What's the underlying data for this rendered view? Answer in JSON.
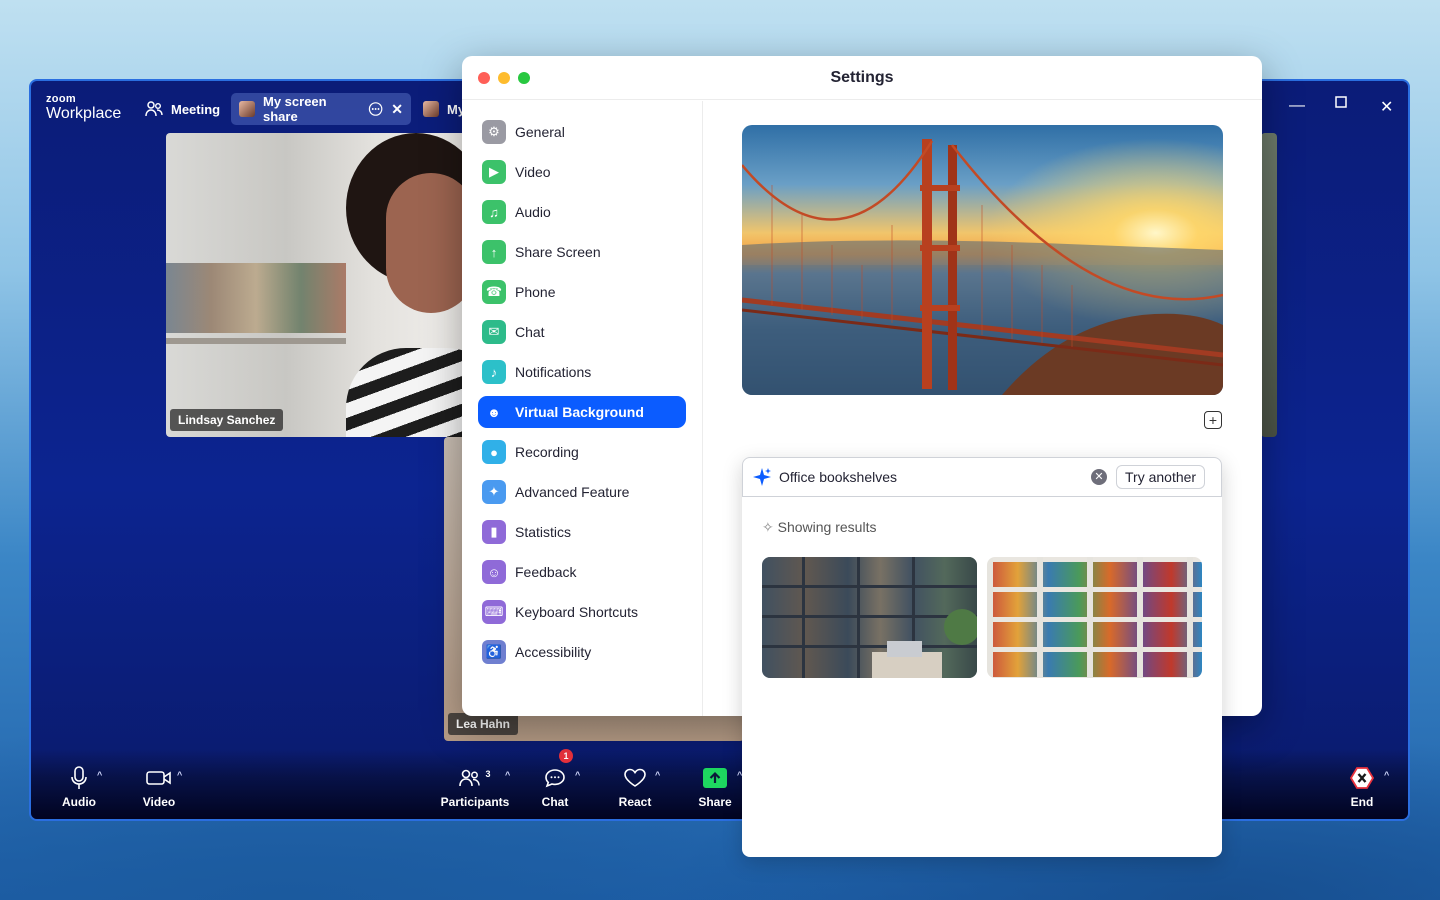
{
  "app": {
    "logo_top": "zoom",
    "logo_bottom": "Workplace",
    "tabs": [
      {
        "label": "Meeting"
      },
      {
        "label": "My screen share"
      },
      {
        "label": "My"
      }
    ]
  },
  "participants": [
    {
      "name": "Lindsay Sanchez"
    },
    {
      "name": "Lea Hahn"
    }
  ],
  "toolbar": {
    "audio": "Audio",
    "video": "Video",
    "participants": "Participants",
    "participants_count": "3",
    "chat": "Chat",
    "chat_badge": "1",
    "react": "React",
    "share": "Share",
    "end": "End"
  },
  "settings": {
    "title": "Settings",
    "nav": [
      {
        "label": "General",
        "icon": "gear-icon",
        "color": "#9a9aa3"
      },
      {
        "label": "Video",
        "icon": "video-icon",
        "color": "#3cc26a"
      },
      {
        "label": "Audio",
        "icon": "headphones-icon",
        "color": "#3cc26a"
      },
      {
        "label": "Share Screen",
        "icon": "share-screen-icon",
        "color": "#3cc26a"
      },
      {
        "label": "Phone",
        "icon": "phone-icon",
        "color": "#3cc26a"
      },
      {
        "label": "Chat",
        "icon": "chat-icon",
        "color": "#2dbb8a"
      },
      {
        "label": "Notifications",
        "icon": "bell-icon",
        "color": "#2cc0c9"
      },
      {
        "label": "Virtual Background",
        "icon": "person-icon",
        "color": "#0b5cff"
      },
      {
        "label": "Recording",
        "icon": "record-icon",
        "color": "#30b0e8"
      },
      {
        "label": "Advanced Feature",
        "icon": "sparkle-icon",
        "color": "#4a9af0"
      },
      {
        "label": "Statistics",
        "icon": "stats-icon",
        "color": "#8f6ad8"
      },
      {
        "label": "Feedback",
        "icon": "smile-icon",
        "color": "#8f6ad8"
      },
      {
        "label": "Keyboard Shortcuts",
        "icon": "keyboard-icon",
        "color": "#8f6ad8"
      },
      {
        "label": "Accessibility",
        "icon": "accessibility-icon",
        "color": "#6f7fd0"
      }
    ],
    "active_index": 7,
    "generator": {
      "prompt_value": "Office bookshelves",
      "try_another": "Try another",
      "status": "Showing results"
    }
  },
  "colors": {
    "accent": "#0b5cff",
    "share_green": "#1ed760",
    "end_red": "#e8313c"
  }
}
